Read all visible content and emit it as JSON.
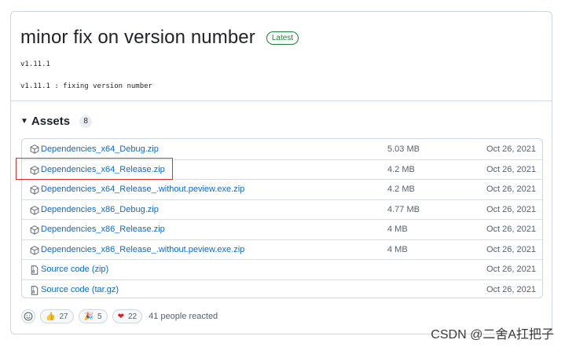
{
  "release": {
    "title": "minor fix on version number",
    "badge": "Latest",
    "tag": "v1.11.1",
    "body": "v1.11.1 : fixing version number"
  },
  "assets": {
    "title": "Assets",
    "count": "8",
    "rows": [
      {
        "name": "Dependencies_x64_Debug.zip",
        "size": "5.03 MB",
        "date": "Oct 26, 2021",
        "icon": "package-icon"
      },
      {
        "name": "Dependencies_x64_Release.zip",
        "size": "4.2 MB",
        "date": "Oct 26, 2021",
        "icon": "package-icon"
      },
      {
        "name": "Dependencies_x64_Release_.without.peview.exe.zip",
        "size": "4.2 MB",
        "date": "Oct 26, 2021",
        "icon": "package-icon"
      },
      {
        "name": "Dependencies_x86_Debug.zip",
        "size": "4.77 MB",
        "date": "Oct 26, 2021",
        "icon": "package-icon"
      },
      {
        "name": "Dependencies_x86_Release.zip",
        "size": "4 MB",
        "date": "Oct 26, 2021",
        "icon": "package-icon"
      },
      {
        "name": "Dependencies_x86_Release_.without.peview.exe.zip",
        "size": "4 MB",
        "date": "Oct 26, 2021",
        "icon": "package-icon"
      },
      {
        "name": "Source code",
        "suffix": "(zip)",
        "size": "",
        "date": "Oct 26, 2021",
        "icon": "file-zip-icon"
      },
      {
        "name": "Source code",
        "suffix": "(tar.gz)",
        "size": "",
        "date": "Oct 26, 2021",
        "icon": "file-zip-icon"
      }
    ]
  },
  "reactions": {
    "items": [
      {
        "emoji": "👍",
        "count": "27"
      },
      {
        "emoji": "🎉",
        "count": "5"
      },
      {
        "emoji": "❤",
        "count": "22"
      }
    ],
    "summary": "41 people reacted"
  },
  "watermark": "CSDN @二舍A扛把子",
  "colors": {
    "link": "#0969da",
    "latest": "#1a7f37",
    "highlight": "#e0302a"
  }
}
